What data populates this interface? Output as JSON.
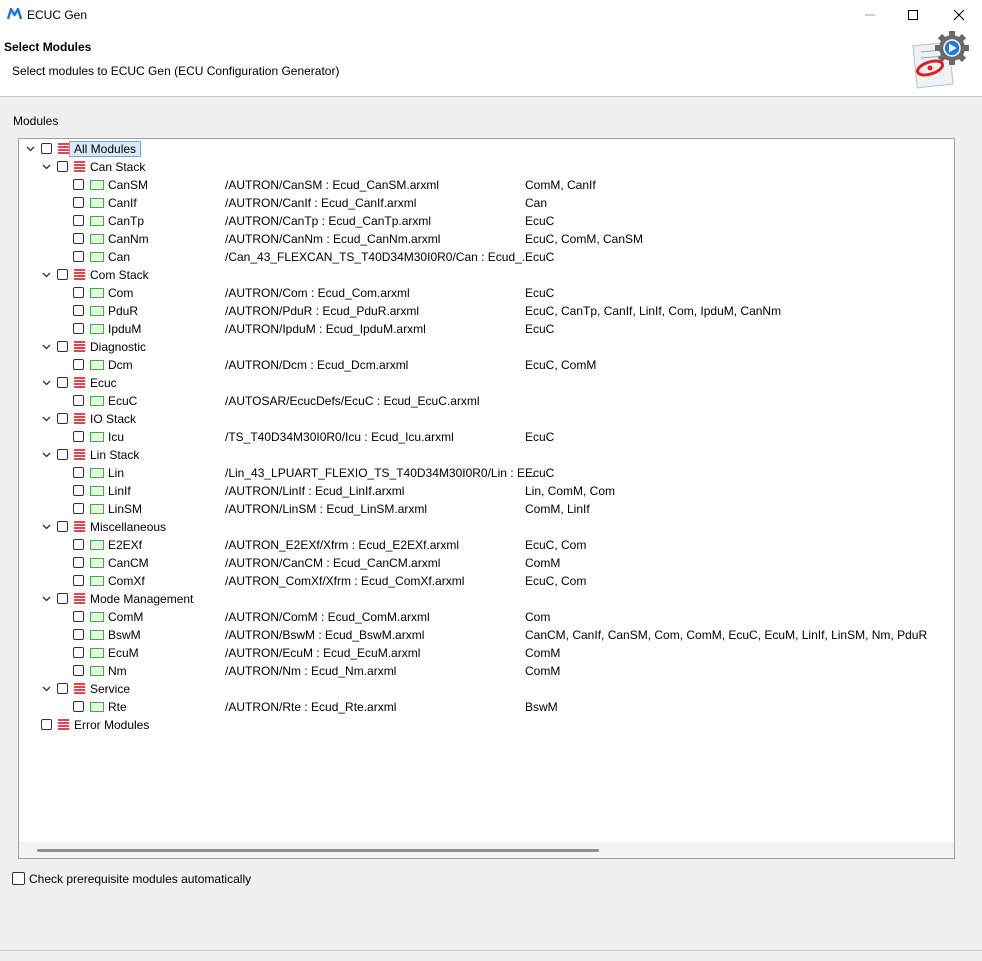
{
  "window": {
    "title": "ECUC Gen"
  },
  "header": {
    "title": "Select Modules",
    "description": "Select modules to ECUC Gen (ECU Configuration Generator)"
  },
  "modules_label": "Modules",
  "tree": [
    {
      "level": 0,
      "type": "root",
      "expand": true,
      "label": "All Modules",
      "path": "",
      "deps": "",
      "selected": true
    },
    {
      "level": 1,
      "type": "group",
      "expand": true,
      "label": "Can Stack",
      "path": "",
      "deps": ""
    },
    {
      "level": 2,
      "type": "module",
      "expand": false,
      "label": "CanSM",
      "path": "/AUTRON/CanSM : Ecud_CanSM.arxml",
      "deps": "ComM, CanIf"
    },
    {
      "level": 2,
      "type": "module",
      "expand": false,
      "label": "CanIf",
      "path": "/AUTRON/CanIf : Ecud_CanIf.arxml",
      "deps": "Can"
    },
    {
      "level": 2,
      "type": "module",
      "expand": false,
      "label": "CanTp",
      "path": "/AUTRON/CanTp : Ecud_CanTp.arxml",
      "deps": "EcuC"
    },
    {
      "level": 2,
      "type": "module",
      "expand": false,
      "label": "CanNm",
      "path": "/AUTRON/CanNm : Ecud_CanNm.arxml",
      "deps": "EcuC, ComM, CanSM"
    },
    {
      "level": 2,
      "type": "module",
      "expand": false,
      "label": "Can",
      "path": "/Can_43_FLEXCAN_TS_T40D34M30I0R0/Can : Ecud_...",
      "deps": "EcuC"
    },
    {
      "level": 1,
      "type": "group",
      "expand": true,
      "label": "Com Stack",
      "path": "",
      "deps": ""
    },
    {
      "level": 2,
      "type": "module",
      "expand": false,
      "label": "Com",
      "path": "/AUTRON/Com : Ecud_Com.arxml",
      "deps": "EcuC"
    },
    {
      "level": 2,
      "type": "module",
      "expand": false,
      "label": "PduR",
      "path": "/AUTRON/PduR : Ecud_PduR.arxml",
      "deps": "EcuC, CanTp, CanIf, LinIf, Com, IpduM, CanNm"
    },
    {
      "level": 2,
      "type": "module",
      "expand": false,
      "label": "IpduM",
      "path": "/AUTRON/IpduM : Ecud_IpduM.arxml",
      "deps": "EcuC"
    },
    {
      "level": 1,
      "type": "group",
      "expand": true,
      "label": "Diagnostic",
      "path": "",
      "deps": ""
    },
    {
      "level": 2,
      "type": "module",
      "expand": false,
      "label": "Dcm",
      "path": "/AUTRON/Dcm : Ecud_Dcm.arxml",
      "deps": "EcuC, ComM"
    },
    {
      "level": 1,
      "type": "group",
      "expand": true,
      "label": "Ecuc",
      "path": "",
      "deps": ""
    },
    {
      "level": 2,
      "type": "module",
      "expand": false,
      "label": "EcuC",
      "path": "/AUTOSAR/EcucDefs/EcuC : Ecud_EcuC.arxml",
      "deps": ""
    },
    {
      "level": 1,
      "type": "group",
      "expand": true,
      "label": "IO Stack",
      "path": "",
      "deps": ""
    },
    {
      "level": 2,
      "type": "module",
      "expand": false,
      "label": "Icu",
      "path": "/TS_T40D34M30I0R0/Icu : Ecud_Icu.arxml",
      "deps": "EcuC"
    },
    {
      "level": 1,
      "type": "group",
      "expand": true,
      "label": "Lin Stack",
      "path": "",
      "deps": ""
    },
    {
      "level": 2,
      "type": "module",
      "expand": false,
      "label": "Lin",
      "path": "/Lin_43_LPUART_FLEXIO_TS_T40D34M30I0R0/Lin : E...",
      "deps": "EcuC"
    },
    {
      "level": 2,
      "type": "module",
      "expand": false,
      "label": "LinIf",
      "path": "/AUTRON/LinIf : Ecud_LinIf.arxml",
      "deps": "Lin, ComM, Com"
    },
    {
      "level": 2,
      "type": "module",
      "expand": false,
      "label": "LinSM",
      "path": "/AUTRON/LinSM : Ecud_LinSM.arxml",
      "deps": "ComM, LinIf"
    },
    {
      "level": 1,
      "type": "group",
      "expand": true,
      "label": "Miscellaneous",
      "path": "",
      "deps": ""
    },
    {
      "level": 2,
      "type": "module",
      "expand": false,
      "label": "E2EXf",
      "path": "/AUTRON_E2EXf/Xfrm : Ecud_E2EXf.arxml",
      "deps": "EcuC, Com"
    },
    {
      "level": 2,
      "type": "module",
      "expand": false,
      "label": "CanCM",
      "path": "/AUTRON/CanCM : Ecud_CanCM.arxml",
      "deps": "ComM"
    },
    {
      "level": 2,
      "type": "module",
      "expand": false,
      "label": "ComXf",
      "path": "/AUTRON_ComXf/Xfrm : Ecud_ComXf.arxml",
      "deps": "EcuC, Com"
    },
    {
      "level": 1,
      "type": "group",
      "expand": true,
      "label": "Mode Management",
      "path": "",
      "deps": ""
    },
    {
      "level": 2,
      "type": "module",
      "expand": false,
      "label": "ComM",
      "path": "/AUTRON/ComM : Ecud_ComM.arxml",
      "deps": "Com"
    },
    {
      "level": 2,
      "type": "module",
      "expand": false,
      "label": "BswM",
      "path": "/AUTRON/BswM : Ecud_BswM.arxml",
      "deps": "CanCM, CanIf, CanSM, Com, ComM, EcuC, EcuM, LinIf, LinSM, Nm, PduR"
    },
    {
      "level": 2,
      "type": "module",
      "expand": false,
      "label": "EcuM",
      "path": "/AUTRON/EcuM : Ecud_EcuM.arxml",
      "deps": "ComM"
    },
    {
      "level": 2,
      "type": "module",
      "expand": false,
      "label": "Nm",
      "path": "/AUTRON/Nm : Ecud_Nm.arxml",
      "deps": "ComM"
    },
    {
      "level": 1,
      "type": "group",
      "expand": true,
      "label": "Service",
      "path": "",
      "deps": ""
    },
    {
      "level": 2,
      "type": "module",
      "expand": false,
      "label": "Rte",
      "path": "/AUTRON/Rte : Ecud_Rte.arxml",
      "deps": "BswM"
    },
    {
      "level": 0,
      "type": "root",
      "expand": false,
      "label": "Error Modules",
      "path": "",
      "deps": ""
    }
  ],
  "options": {
    "prereq_label": "Check prerequisite modules automatically",
    "prereq_checked": false
  }
}
